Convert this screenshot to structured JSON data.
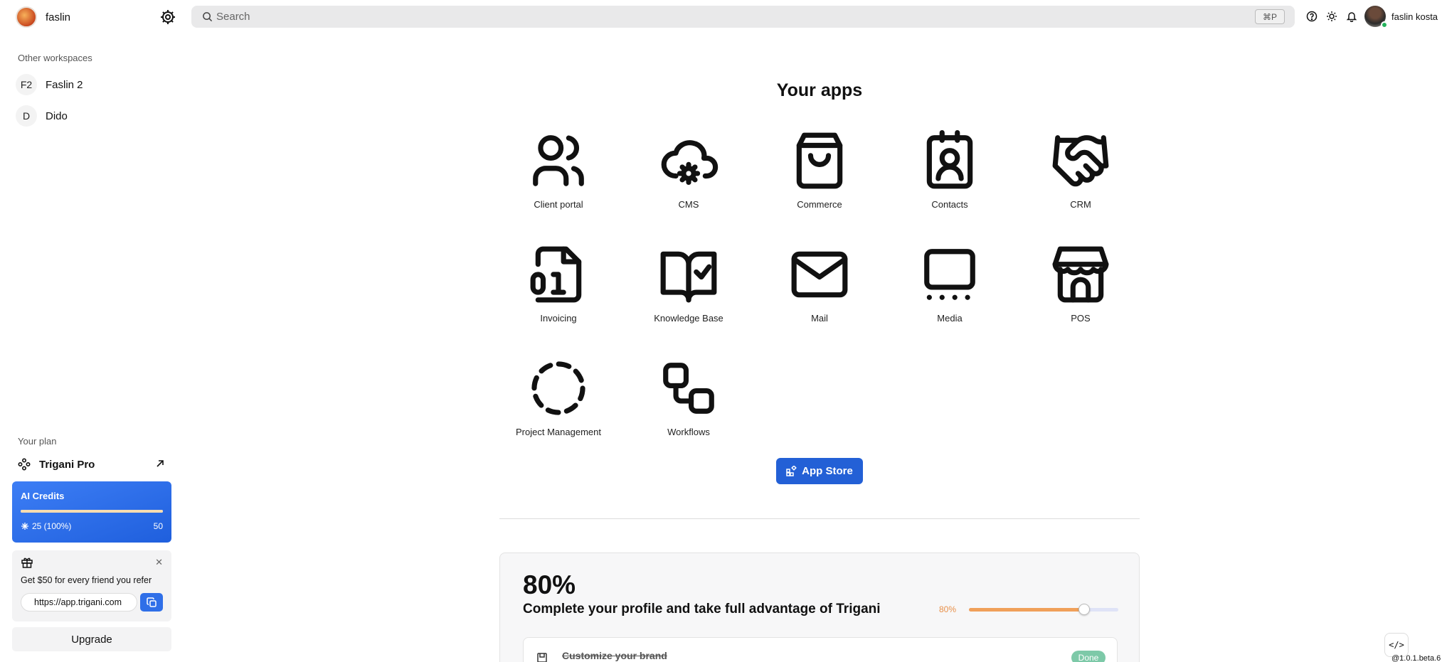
{
  "workspace": {
    "name": "faslin",
    "other_workspaces_label": "Other workspaces",
    "others": [
      {
        "initials": "F2",
        "name": "Faslin 2"
      },
      {
        "initials": "D",
        "name": "Dido"
      }
    ]
  },
  "search": {
    "placeholder": "Search",
    "shortcut": "⌘P"
  },
  "topbar_icons": [
    "help-icon",
    "theme-sun-icon",
    "notifications-bell-icon"
  ],
  "user": {
    "name": "faslin kosta",
    "status_color": "#23b25b"
  },
  "main": {
    "title": "Your apps",
    "apps": [
      {
        "label": "Client portal",
        "icon": "users-icon"
      },
      {
        "label": "CMS",
        "icon": "cloud-gear-icon"
      },
      {
        "label": "Commerce",
        "icon": "shopping-bag-icon"
      },
      {
        "label": "Contacts",
        "icon": "contact-card-icon"
      },
      {
        "label": "CRM",
        "icon": "handshake-icon"
      },
      {
        "label": "Invoicing",
        "icon": "binary-file-icon"
      },
      {
        "label": "Knowledge Base",
        "icon": "book-check-icon"
      },
      {
        "label": "Mail",
        "icon": "mail-icon"
      },
      {
        "label": "Media",
        "icon": "media-screen-icon"
      },
      {
        "label": "POS",
        "icon": "store-icon"
      },
      {
        "label": "Project Management",
        "icon": "dashed-circle-icon"
      },
      {
        "label": "Workflows",
        "icon": "workflow-icon"
      }
    ],
    "app_store_label": "App Store",
    "accent_color": "#2360d6"
  },
  "plan": {
    "label": "Your plan",
    "name": "Trigani Pro",
    "credits": {
      "title": "AI Credits",
      "used_text": "25 (100%)",
      "total": "50",
      "fill_fraction": 1.0
    },
    "referral": {
      "text": "Get $50 for every friend you refer",
      "url": "https://app.trigani.com"
    },
    "upgrade_label": "Upgrade"
  },
  "profile_progress": {
    "percent_text": "80%",
    "subtitle": "Complete your profile and take full advantage of Trigani",
    "slider_label": "80%",
    "value": 0.8,
    "tasks": [
      {
        "label": "Customize your brand",
        "status": "Done",
        "completed": true
      }
    ]
  },
  "footer": {
    "code_button": "</>",
    "version": "@1.0.1.beta.6"
  }
}
